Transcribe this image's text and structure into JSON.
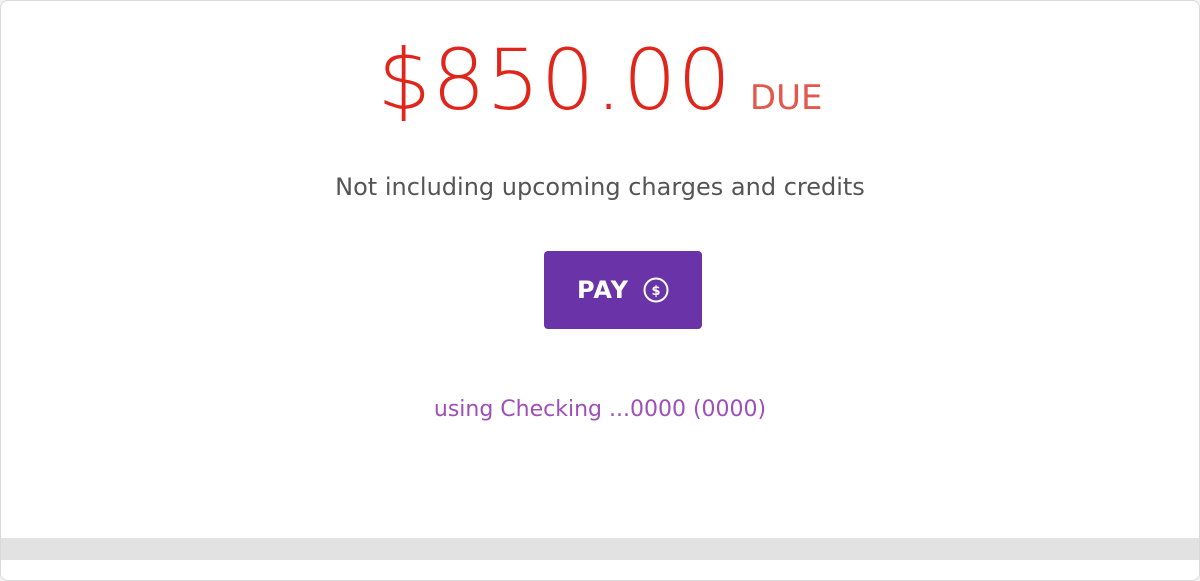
{
  "balance": {
    "amount": "$850.00",
    "due_label": "DUE",
    "subtitle": "Not including upcoming charges and credits"
  },
  "pay_button": {
    "label": "PAY",
    "icon": "dollar-coin-icon"
  },
  "payment_method": {
    "text": "using Checking ...0000 (0000)"
  },
  "colors": {
    "amount": "#e0261b",
    "due": "#e2584c",
    "button": "#6a33a8",
    "account": "#9e4fb8"
  }
}
